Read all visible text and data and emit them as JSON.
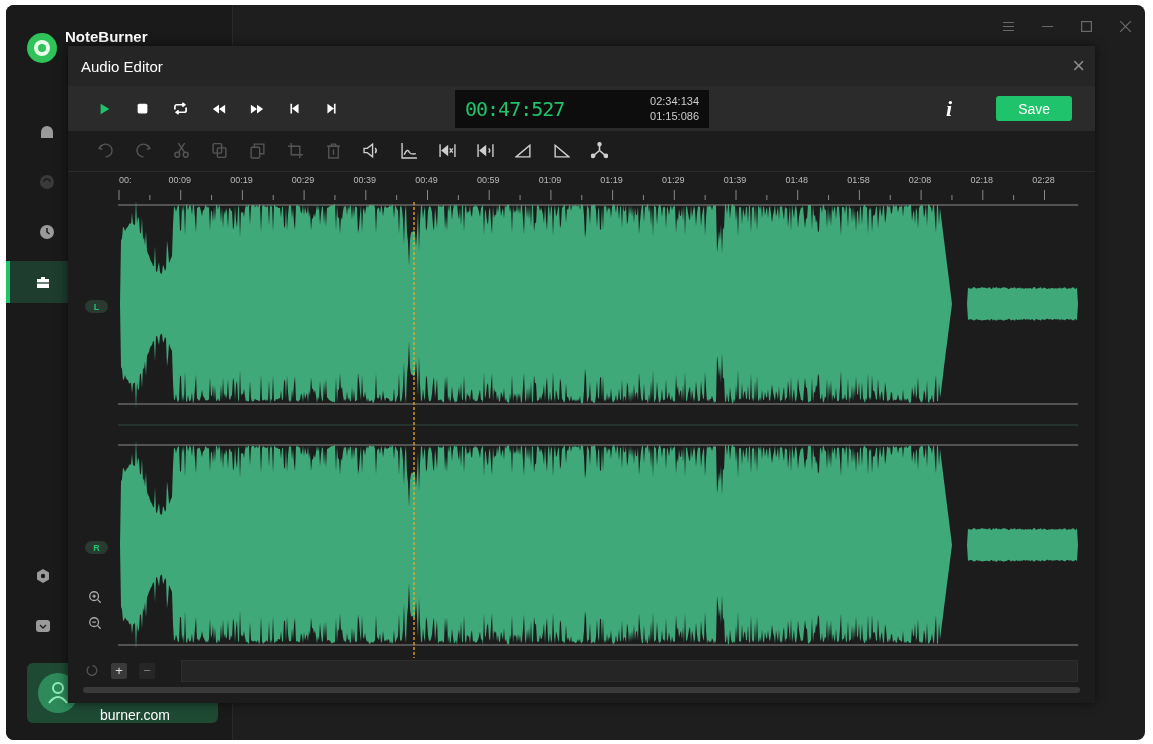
{
  "app": {
    "title": "NoteBurner",
    "account": "burner.com"
  },
  "window_controls": [
    {
      "kind": "menu"
    },
    {
      "kind": "minimize"
    },
    {
      "kind": "maximize"
    },
    {
      "kind": "close"
    }
  ],
  "sidebar": {
    "items": [
      {
        "kind": "home",
        "selected": false,
        "disabled": false
      },
      {
        "kind": "sync",
        "selected": false,
        "disabled": true
      },
      {
        "kind": "clock",
        "selected": false,
        "disabled": false
      },
      {
        "kind": "toolbox",
        "selected": true,
        "disabled": false
      }
    ],
    "bottom_items": [
      {
        "kind": "gear"
      },
      {
        "kind": "mail"
      }
    ]
  },
  "dialog": {
    "title": "Audio Editor",
    "close": "×",
    "transport": [
      {
        "kind": "play"
      },
      {
        "kind": "stop"
      },
      {
        "kind": "loop"
      },
      {
        "kind": "rewind"
      },
      {
        "kind": "forward"
      },
      {
        "kind": "start"
      },
      {
        "kind": "end"
      }
    ],
    "time": {
      "current": "00:47:527",
      "total": "02:34:134",
      "selection": "01:15:086"
    },
    "info": "i",
    "save": "Save",
    "tools": [
      {
        "kind": "undo",
        "disabled": true
      },
      {
        "kind": "redo",
        "disabled": true
      },
      {
        "kind": "cut",
        "disabled": true
      },
      {
        "kind": "copy",
        "disabled": true
      },
      {
        "kind": "paste",
        "disabled": true
      },
      {
        "kind": "crop",
        "disabled": true
      },
      {
        "kind": "delete",
        "disabled": true
      },
      {
        "kind": "volume",
        "disabled": false
      },
      {
        "kind": "envelope",
        "disabled": false
      },
      {
        "kind": "mute",
        "disabled": false
      },
      {
        "kind": "silence",
        "disabled": false
      },
      {
        "kind": "fade-in",
        "disabled": false
      },
      {
        "kind": "fade-out",
        "disabled": false
      },
      {
        "kind": "split",
        "disabled": false
      }
    ],
    "timeline": [
      "00:",
      "00:09",
      "00:19",
      "00:29",
      "00:39",
      "00:49",
      "00:59",
      "01:09",
      "01:19",
      "01:29",
      "01:39",
      "01:48",
      "01:58",
      "02:08",
      "02:18",
      "02:28"
    ],
    "channels": [
      "L",
      "R"
    ],
    "zoom": [
      {
        "kind": "zoom-in"
      },
      {
        "kind": "zoom-out"
      }
    ],
    "bottom_controls": [
      {
        "kind": "reset",
        "disabled": true
      },
      {
        "kind": "add",
        "label": "+",
        "disabled": false
      },
      {
        "kind": "remove",
        "label": "−",
        "disabled": true
      }
    ]
  }
}
